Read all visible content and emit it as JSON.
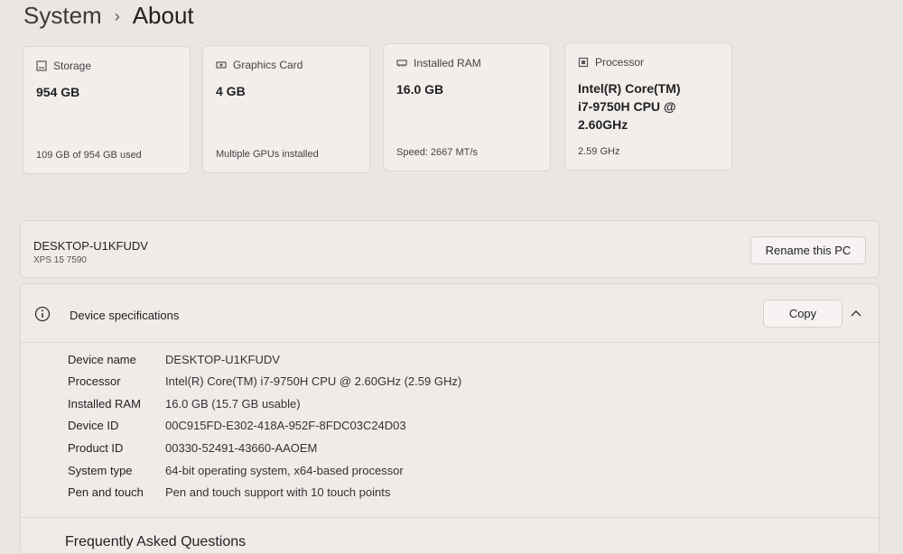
{
  "breadcrumb": {
    "parent": "System",
    "separator": "›",
    "current": "About"
  },
  "cards": [
    {
      "icon": "storage-icon",
      "label": "Storage",
      "value": "954 GB",
      "sub": "109 GB of 954 GB used"
    },
    {
      "icon": "graphics-card-icon",
      "label": "Graphics Card",
      "value": "4 GB",
      "sub": "Multiple GPUs installed"
    },
    {
      "icon": "ram-icon",
      "label": "Installed RAM",
      "value": "16.0 GB",
      "sub": "Speed: 2667 MT/s"
    },
    {
      "icon": "processor-icon",
      "label": "Processor",
      "value_lines": [
        "Intel(R) Core(TM)",
        "i7-9750H CPU @",
        "2.60GHz"
      ],
      "sub": "2.59 GHz"
    }
  ],
  "device": {
    "name": "DESKTOP-U1KFUDV",
    "model": "XPS 15 7590",
    "rename_label": "Rename this PC"
  },
  "specs": {
    "title": "Device specifications",
    "copy_label": "Copy",
    "rows": [
      {
        "label": "Device name",
        "value": "DESKTOP-U1KFUDV"
      },
      {
        "label": "Processor",
        "value": "Intel(R) Core(TM) i7-9750H CPU @ 2.60GHz (2.59 GHz)"
      },
      {
        "label": "Installed RAM",
        "value": "16.0 GB (15.7 GB usable)"
      },
      {
        "label": "Device ID",
        "value": "00C915FD-E302-418A-952F-8FDC03C24D03"
      },
      {
        "label": "Product ID",
        "value": "00330-52491-43660-AAOEM"
      },
      {
        "label": "System type",
        "value": "64-bit operating system, x64-based processor"
      },
      {
        "label": "Pen and touch",
        "value": "Pen and touch support with 10 touch points"
      }
    ]
  },
  "faq": {
    "title": "Frequently Asked Questions"
  }
}
